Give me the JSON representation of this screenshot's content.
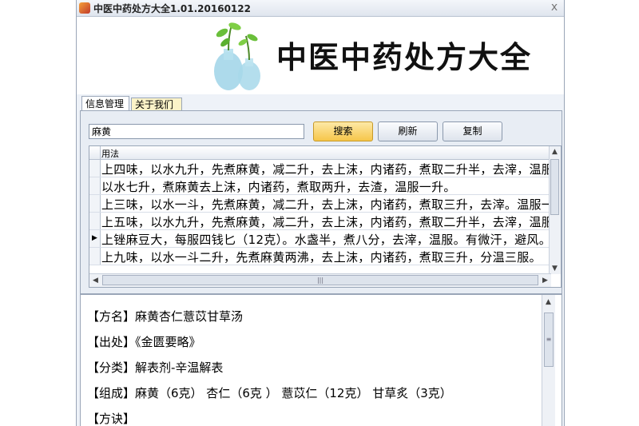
{
  "window": {
    "title": "中医中药处方大全1.01.20160122",
    "close_glyph": "x"
  },
  "banner": {
    "logo_text": "中医中药处方大全"
  },
  "tabs": [
    {
      "label": "信息管理"
    },
    {
      "label": "关于我们"
    }
  ],
  "search": {
    "value": "麻黄",
    "search_label": "搜索",
    "refresh_label": "刷新",
    "copy_label": "复制"
  },
  "grid": {
    "column": "用法",
    "current_row_marker": "▶",
    "rows": [
      "上四味，以水九升，先煮麻黄，减二升，去上沫，内诸药，煮取二升半，去滓，温服八合。",
      "以水七升，煮麻黄去上沫，内诸药，煮取两升，去渣，温服一升。",
      "上三味，以水一斗，先煮麻黄，减二升，去上沫，内诸药，煮取三升，去滓。温服一升。",
      "上五味，以水九升，先煮麻黄，减二升，去上沫，内诸药，煮取二升半，去滓，温服八合。",
      "上锉麻豆大，每服四钱匕（12克）。水盏半，煮八分，去滓，温服。有微汗，避风。",
      "上九味，以水一斗二升，先煮麻黄两沸，去上沫，内诸药，煮取三升，分温三服。"
    ]
  },
  "detail": {
    "lines": [
      "【方名】麻黄杏仁薏苡甘草汤",
      "【出处】《金匮要略》",
      "【分类】解表剂-辛温解表",
      "【组成】麻黄（6克） 杏仁（6克 ） 薏苡仁（12克） 甘草炙（3克）",
      "【方诀】"
    ]
  },
  "colors": {
    "window_bg": "#eef2f8",
    "primary_button": "#f6c64a"
  }
}
